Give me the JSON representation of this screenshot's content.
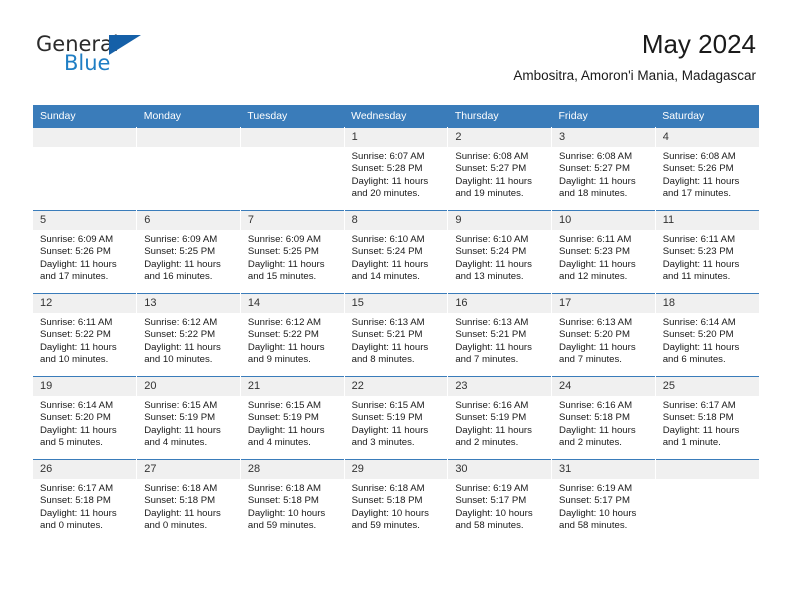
{
  "brand": {
    "name_top": "General",
    "name_bottom": "Blue",
    "flag_icon": "blue-triangle-flag",
    "accent_color": "#1560a8",
    "blue_text_color": "#1f7ec4"
  },
  "header": {
    "title": "May 2024",
    "subtitle": "Ambositra, Amoron'i Mania, Madagascar"
  },
  "calendar": {
    "header_bg": "#3a7cba",
    "daynum_bg": "#f0f0f0",
    "weekday_headers": [
      "Sunday",
      "Monday",
      "Tuesday",
      "Wednesday",
      "Thursday",
      "Friday",
      "Saturday"
    ],
    "labels": {
      "sunrise": "Sunrise:",
      "sunset": "Sunset:",
      "daylight": "Daylight:"
    },
    "weeks": [
      [
        {
          "day": "",
          "lines": []
        },
        {
          "day": "",
          "lines": []
        },
        {
          "day": "",
          "lines": []
        },
        {
          "day": "1",
          "lines": [
            "Sunrise: 6:07 AM",
            "Sunset: 5:28 PM",
            "Daylight: 11 hours",
            "and 20 minutes."
          ]
        },
        {
          "day": "2",
          "lines": [
            "Sunrise: 6:08 AM",
            "Sunset: 5:27 PM",
            "Daylight: 11 hours",
            "and 19 minutes."
          ]
        },
        {
          "day": "3",
          "lines": [
            "Sunrise: 6:08 AM",
            "Sunset: 5:27 PM",
            "Daylight: 11 hours",
            "and 18 minutes."
          ]
        },
        {
          "day": "4",
          "lines": [
            "Sunrise: 6:08 AM",
            "Sunset: 5:26 PM",
            "Daylight: 11 hours",
            "and 17 minutes."
          ]
        }
      ],
      [
        {
          "day": "5",
          "lines": [
            "Sunrise: 6:09 AM",
            "Sunset: 5:26 PM",
            "Daylight: 11 hours",
            "and 17 minutes."
          ]
        },
        {
          "day": "6",
          "lines": [
            "Sunrise: 6:09 AM",
            "Sunset: 5:25 PM",
            "Daylight: 11 hours",
            "and 16 minutes."
          ]
        },
        {
          "day": "7",
          "lines": [
            "Sunrise: 6:09 AM",
            "Sunset: 5:25 PM",
            "Daylight: 11 hours",
            "and 15 minutes."
          ]
        },
        {
          "day": "8",
          "lines": [
            "Sunrise: 6:10 AM",
            "Sunset: 5:24 PM",
            "Daylight: 11 hours",
            "and 14 minutes."
          ]
        },
        {
          "day": "9",
          "lines": [
            "Sunrise: 6:10 AM",
            "Sunset: 5:24 PM",
            "Daylight: 11 hours",
            "and 13 minutes."
          ]
        },
        {
          "day": "10",
          "lines": [
            "Sunrise: 6:11 AM",
            "Sunset: 5:23 PM",
            "Daylight: 11 hours",
            "and 12 minutes."
          ]
        },
        {
          "day": "11",
          "lines": [
            "Sunrise: 6:11 AM",
            "Sunset: 5:23 PM",
            "Daylight: 11 hours",
            "and 11 minutes."
          ]
        }
      ],
      [
        {
          "day": "12",
          "lines": [
            "Sunrise: 6:11 AM",
            "Sunset: 5:22 PM",
            "Daylight: 11 hours",
            "and 10 minutes."
          ]
        },
        {
          "day": "13",
          "lines": [
            "Sunrise: 6:12 AM",
            "Sunset: 5:22 PM",
            "Daylight: 11 hours",
            "and 10 minutes."
          ]
        },
        {
          "day": "14",
          "lines": [
            "Sunrise: 6:12 AM",
            "Sunset: 5:22 PM",
            "Daylight: 11 hours",
            "and 9 minutes."
          ]
        },
        {
          "day": "15",
          "lines": [
            "Sunrise: 6:13 AM",
            "Sunset: 5:21 PM",
            "Daylight: 11 hours",
            "and 8 minutes."
          ]
        },
        {
          "day": "16",
          "lines": [
            "Sunrise: 6:13 AM",
            "Sunset: 5:21 PM",
            "Daylight: 11 hours",
            "and 7 minutes."
          ]
        },
        {
          "day": "17",
          "lines": [
            "Sunrise: 6:13 AM",
            "Sunset: 5:20 PM",
            "Daylight: 11 hours",
            "and 7 minutes."
          ]
        },
        {
          "day": "18",
          "lines": [
            "Sunrise: 6:14 AM",
            "Sunset: 5:20 PM",
            "Daylight: 11 hours",
            "and 6 minutes."
          ]
        }
      ],
      [
        {
          "day": "19",
          "lines": [
            "Sunrise: 6:14 AM",
            "Sunset: 5:20 PM",
            "Daylight: 11 hours",
            "and 5 minutes."
          ]
        },
        {
          "day": "20",
          "lines": [
            "Sunrise: 6:15 AM",
            "Sunset: 5:19 PM",
            "Daylight: 11 hours",
            "and 4 minutes."
          ]
        },
        {
          "day": "21",
          "lines": [
            "Sunrise: 6:15 AM",
            "Sunset: 5:19 PM",
            "Daylight: 11 hours",
            "and 4 minutes."
          ]
        },
        {
          "day": "22",
          "lines": [
            "Sunrise: 6:15 AM",
            "Sunset: 5:19 PM",
            "Daylight: 11 hours",
            "and 3 minutes."
          ]
        },
        {
          "day": "23",
          "lines": [
            "Sunrise: 6:16 AM",
            "Sunset: 5:19 PM",
            "Daylight: 11 hours",
            "and 2 minutes."
          ]
        },
        {
          "day": "24",
          "lines": [
            "Sunrise: 6:16 AM",
            "Sunset: 5:18 PM",
            "Daylight: 11 hours",
            "and 2 minutes."
          ]
        },
        {
          "day": "25",
          "lines": [
            "Sunrise: 6:17 AM",
            "Sunset: 5:18 PM",
            "Daylight: 11 hours",
            "and 1 minute."
          ]
        }
      ],
      [
        {
          "day": "26",
          "lines": [
            "Sunrise: 6:17 AM",
            "Sunset: 5:18 PM",
            "Daylight: 11 hours",
            "and 0 minutes."
          ]
        },
        {
          "day": "27",
          "lines": [
            "Sunrise: 6:18 AM",
            "Sunset: 5:18 PM",
            "Daylight: 11 hours",
            "and 0 minutes."
          ]
        },
        {
          "day": "28",
          "lines": [
            "Sunrise: 6:18 AM",
            "Sunset: 5:18 PM",
            "Daylight: 10 hours",
            "and 59 minutes."
          ]
        },
        {
          "day": "29",
          "lines": [
            "Sunrise: 6:18 AM",
            "Sunset: 5:18 PM",
            "Daylight: 10 hours",
            "and 59 minutes."
          ]
        },
        {
          "day": "30",
          "lines": [
            "Sunrise: 6:19 AM",
            "Sunset: 5:17 PM",
            "Daylight: 10 hours",
            "and 58 minutes."
          ]
        },
        {
          "day": "31",
          "lines": [
            "Sunrise: 6:19 AM",
            "Sunset: 5:17 PM",
            "Daylight: 10 hours",
            "and 58 minutes."
          ]
        },
        {
          "day": "",
          "lines": []
        }
      ]
    ]
  }
}
